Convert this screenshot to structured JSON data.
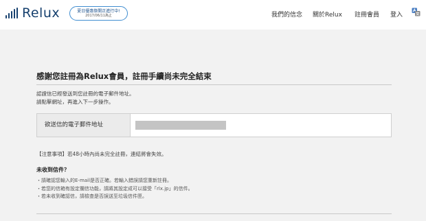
{
  "header": {
    "logo_text": "Relux",
    "promo": {
      "line1": "夏日優惠祭開正進行中!",
      "line2": "2017/06/11為止"
    },
    "nav": [
      "我們的信念",
      "關於Relux",
      "註冊會員",
      "登入"
    ],
    "lang_icon": "translate-icon",
    "brand_color": "#16406e",
    "promo_border_color": "#3f8dd0"
  },
  "main": {
    "title": "感謝您註冊為Relux會員，註冊手續尚未完全結束",
    "desc_line1": "認證信已經發送到您註冊的電子郵件地址。",
    "desc_line2": "請點擊網址，再進入下一步操作。",
    "email_label": "欲送信的電子郵件地址",
    "notice": "【注意事項】若48小時內尚未完全註冊，連結將會失效。",
    "not_received_heading": "未收到信件？",
    "bullets": [
      "・請確認您輸入的E-mail是否正確。若輸入錯誤請您重新註冊。",
      "・若您的信箱有設定攔信功能，請將其設定成可以接受「rlx.jp」的信件。",
      "・若未收到確認信，請檢查是否誤送至垃圾信件匣。"
    ]
  }
}
